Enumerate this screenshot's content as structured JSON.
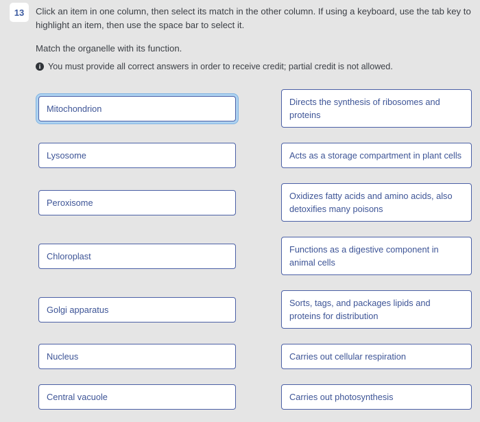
{
  "question": {
    "number": "13",
    "instructions": "Click an item in one column, then select its match in the other column. If using a keyboard, use the tab key to highlight an item, then use the space bar to select it.",
    "sub_prompt": "Match the organelle with its function.",
    "credit_note": "You must provide all correct answers in order to receive credit; partial credit is not allowed.",
    "info_icon_glyph": "i"
  },
  "colors": {
    "page_background": "#e5e5e5",
    "option_border": "#4a5fa5",
    "option_text": "#3d5496",
    "selection_ring": "#aed2f0",
    "number_badge_text": "#3b5aa0",
    "body_text": "#3b3f45"
  },
  "rows": [
    {
      "left": {
        "label": "Mitochondrion",
        "selected": true,
        "lines": 1
      },
      "right": {
        "label": "Directs the synthesis of ribosomes and proteins",
        "selected": false,
        "lines": 2
      }
    },
    {
      "left": {
        "label": "Lysosome",
        "selected": false,
        "lines": 1
      },
      "right": {
        "label": "Acts as a storage compartment in plant cells",
        "selected": false,
        "lines": 1
      }
    },
    {
      "left": {
        "label": "Peroxisome",
        "selected": false,
        "lines": 1
      },
      "right": {
        "label": "Oxidizes fatty acids and amino acids, also detoxifies many poisons",
        "selected": false,
        "lines": 2
      }
    },
    {
      "left": {
        "label": "Chloroplast",
        "selected": false,
        "lines": 1
      },
      "right": {
        "label": "Functions as a digestive component in animal cells",
        "selected": false,
        "lines": 2
      }
    },
    {
      "left": {
        "label": "Golgi apparatus",
        "selected": false,
        "lines": 1
      },
      "right": {
        "label": "Sorts, tags, and packages lipids and proteins for distribution",
        "selected": false,
        "lines": 2
      }
    },
    {
      "left": {
        "label": "Nucleus",
        "selected": false,
        "lines": 1
      },
      "right": {
        "label": "Carries out cellular respiration",
        "selected": false,
        "lines": 1
      }
    },
    {
      "left": {
        "label": "Central vacuole",
        "selected": false,
        "lines": 1
      },
      "right": {
        "label": "Carries out photosynthesis",
        "selected": false,
        "lines": 1
      }
    }
  ]
}
